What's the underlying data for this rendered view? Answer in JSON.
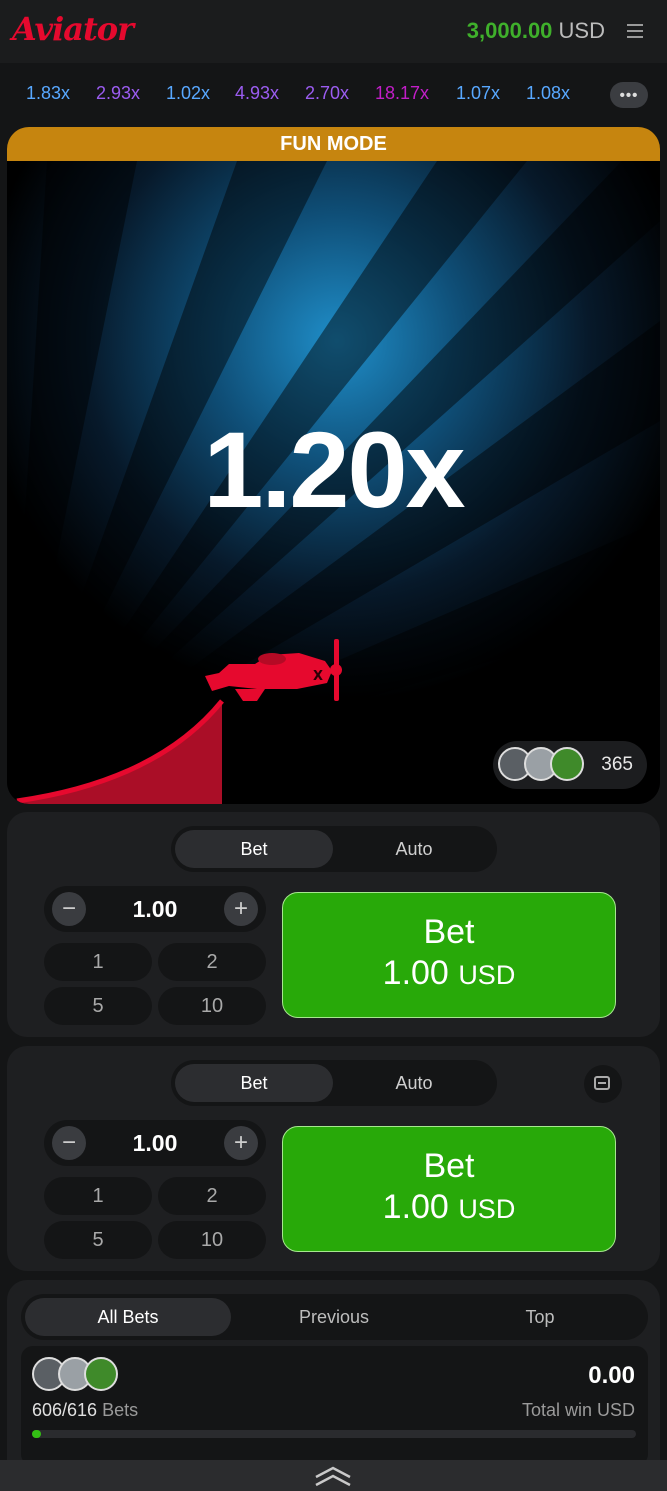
{
  "app": {
    "logo": "Aviator",
    "balance_amount": "3,000.00",
    "balance_currency": "USD"
  },
  "history": [
    {
      "text": "1.83x",
      "color": "#58a8ff"
    },
    {
      "text": "2.93x",
      "color": "#9b5cf0"
    },
    {
      "text": "1.02x",
      "color": "#58a8ff"
    },
    {
      "text": "4.93x",
      "color": "#9b5cf0"
    },
    {
      "text": "2.70x",
      "color": "#9b5cf0"
    },
    {
      "text": "18.17x",
      "color": "#c21ec8"
    },
    {
      "text": "1.07x",
      "color": "#58a8ff"
    },
    {
      "text": "1.08x",
      "color": "#58a8ff"
    }
  ],
  "history_more": "•••",
  "game": {
    "mode_banner": "FUN MODE",
    "multiplier": "1.20x",
    "players_count": "365"
  },
  "panels": [
    {
      "tabs": [
        "Bet",
        "Auto"
      ],
      "active_tab": "Bet",
      "stake": "1.00",
      "minus": "−",
      "plus": "+",
      "quick": [
        "1",
        "2",
        "5",
        "10"
      ],
      "button_title": "Bet",
      "button_amount": "1.00",
      "button_currency": "USD"
    },
    {
      "tabs": [
        "Bet",
        "Auto"
      ],
      "active_tab": "Bet",
      "stake": "1.00",
      "minus": "−",
      "plus": "+",
      "quick": [
        "1",
        "2",
        "5",
        "10"
      ],
      "button_title": "Bet",
      "button_amount": "1.00",
      "button_currency": "USD"
    }
  ],
  "bets": {
    "tabs": [
      "All Bets",
      "Previous",
      "Top"
    ],
    "active_tab": "All Bets",
    "count": "606/616",
    "count_label": "Bets",
    "total": "0.00",
    "total_label": "Total win USD",
    "progress": 0.015
  },
  "colors": {
    "accent_green": "#28a909",
    "brand_red": "#e6092e",
    "fun_banner": "#c6850f"
  }
}
